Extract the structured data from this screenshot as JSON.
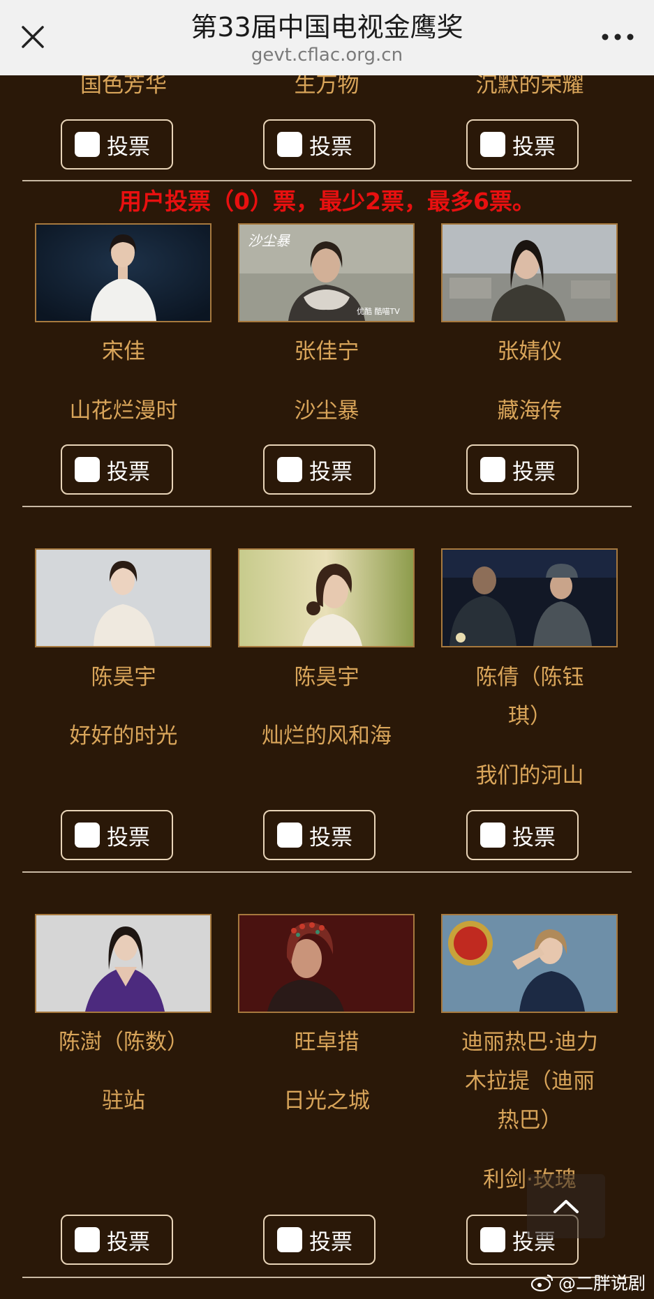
{
  "header": {
    "title": "第33届中国电视金鹰奖",
    "url": "gevt.cflac.org.cn"
  },
  "vote_label": "投票",
  "top_row": [
    {
      "work": "国色芳华"
    },
    {
      "work": "生万物"
    },
    {
      "work": "沉默的荣耀"
    }
  ],
  "notice": "用户投票（0）票，最少2票，最多6票。",
  "rows": [
    [
      {
        "name_lines": [
          "宋佳"
        ],
        "work_lines": [
          "山花烂漫时"
        ]
      },
      {
        "name_lines": [
          "张佳宁"
        ],
        "work_lines": [
          "沙尘暴"
        ]
      },
      {
        "name_lines": [
          "张婧仪"
        ],
        "work_lines": [
          "藏海传"
        ]
      }
    ],
    [
      {
        "name_lines": [
          "陈昊宇"
        ],
        "work_lines": [
          "好好的时光"
        ]
      },
      {
        "name_lines": [
          "陈昊宇"
        ],
        "work_lines": [
          "灿烂的风和海"
        ]
      },
      {
        "name_lines": [
          "陈倩（陈钰",
          "琪）"
        ],
        "work_lines": [
          "我们的河山"
        ]
      }
    ],
    [
      {
        "name_lines": [
          "陈澍（陈数）"
        ],
        "work_lines": [
          "驻站"
        ]
      },
      {
        "name_lines": [
          "旺卓措"
        ],
        "work_lines": [
          "日光之城"
        ]
      },
      {
        "name_lines": [
          "迪丽热巴·迪力",
          "木拉提（迪丽",
          "热巴）"
        ],
        "work_lines": [
          "利剑·玫瑰"
        ]
      }
    ]
  ],
  "watermark": "@二胖说剧"
}
